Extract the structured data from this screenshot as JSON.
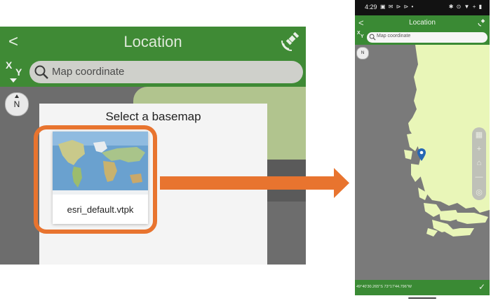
{
  "left_panel": {
    "title": "Location",
    "back_glyph": "<",
    "xy_x": "X",
    "xy_y": "Y",
    "search_placeholder": "Map coordinate",
    "north": "N",
    "dialog_title": "Select a basemap",
    "basemap_name": "esri_default.vtpk",
    "highlight_color": "#e8742f"
  },
  "phone": {
    "time": "4:29",
    "status_left_icons": "▣ ✉ ⊳ ⊳ •",
    "status_right_icons": "✱ ⊙ ▼ + ▮",
    "title": "Location",
    "back_glyph": "<",
    "xy_x": "X",
    "xy_y": "Y",
    "search_placeholder": "Map coordinate",
    "north": "N",
    "coordinate": "49°40'30.265\"S 73°17'44.796\"W",
    "tools": [
      "▦",
      "+",
      "⌂",
      "—",
      "◎"
    ],
    "confirm_glyph": "✓",
    "bar_color": "#3a8a34"
  },
  "icons": [
    "back-icon",
    "satellite-icon",
    "xy-icon",
    "search-icon",
    "north-arrow-icon",
    "location-pin-icon",
    "checkmark-icon",
    "arrow-connector"
  ]
}
